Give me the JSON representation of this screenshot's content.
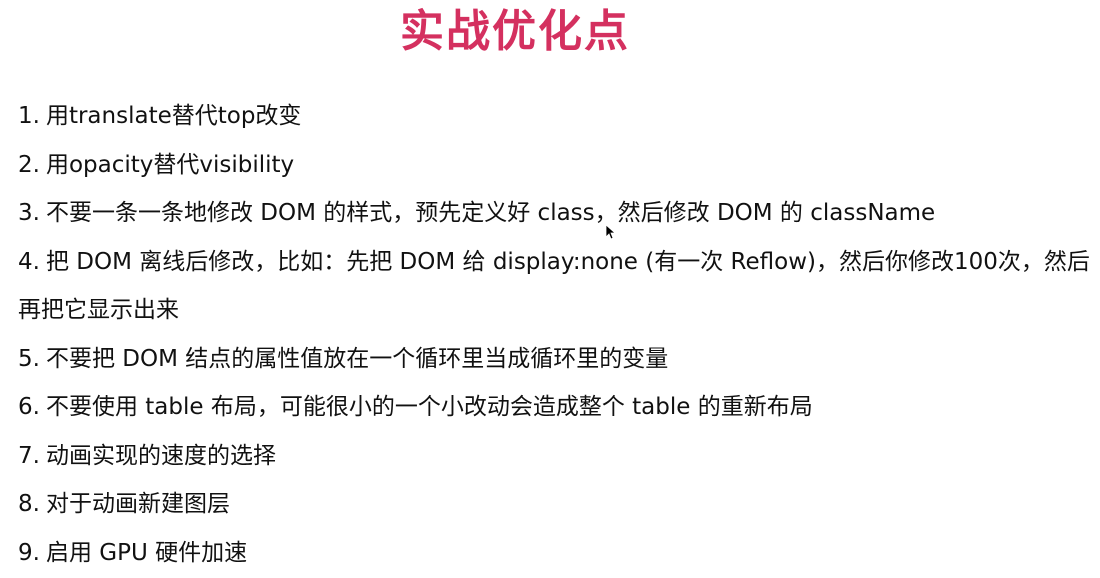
{
  "slide": {
    "title": "实战优化点",
    "items": [
      {
        "num": "1.",
        "text": "用translate替代top改变"
      },
      {
        "num": "2.",
        "text": "用opacity替代visibility"
      },
      {
        "num": "3.",
        "text": "不要一条一条地修改 DOM 的样式，预先定义好 class，然后修改 DOM 的 className"
      },
      {
        "num": "4.",
        "text": "把 DOM 离线后修改，比如：先把 DOM 给 display:none (有一次 Reflow)，然后你修改100次，然后再把它显示出来"
      },
      {
        "num": "5.",
        "text": "不要把 DOM 结点的属性值放在一个循环里当成循环里的变量"
      },
      {
        "num": "6.",
        "text": "不要使用 table 布局，可能很小的一个小改动会造成整个 table 的重新布局"
      },
      {
        "num": "7.",
        "text": "动画实现的速度的选择"
      },
      {
        "num": "8.",
        "text": "对于动画新建图层"
      },
      {
        "num": "9.",
        "text": "启用 GPU 硬件加速"
      }
    ]
  },
  "colors": {
    "title": "#d4305f",
    "text": "#111111",
    "background": "#ffffff"
  },
  "icons": {
    "cursor": "mouse-pointer-icon"
  }
}
